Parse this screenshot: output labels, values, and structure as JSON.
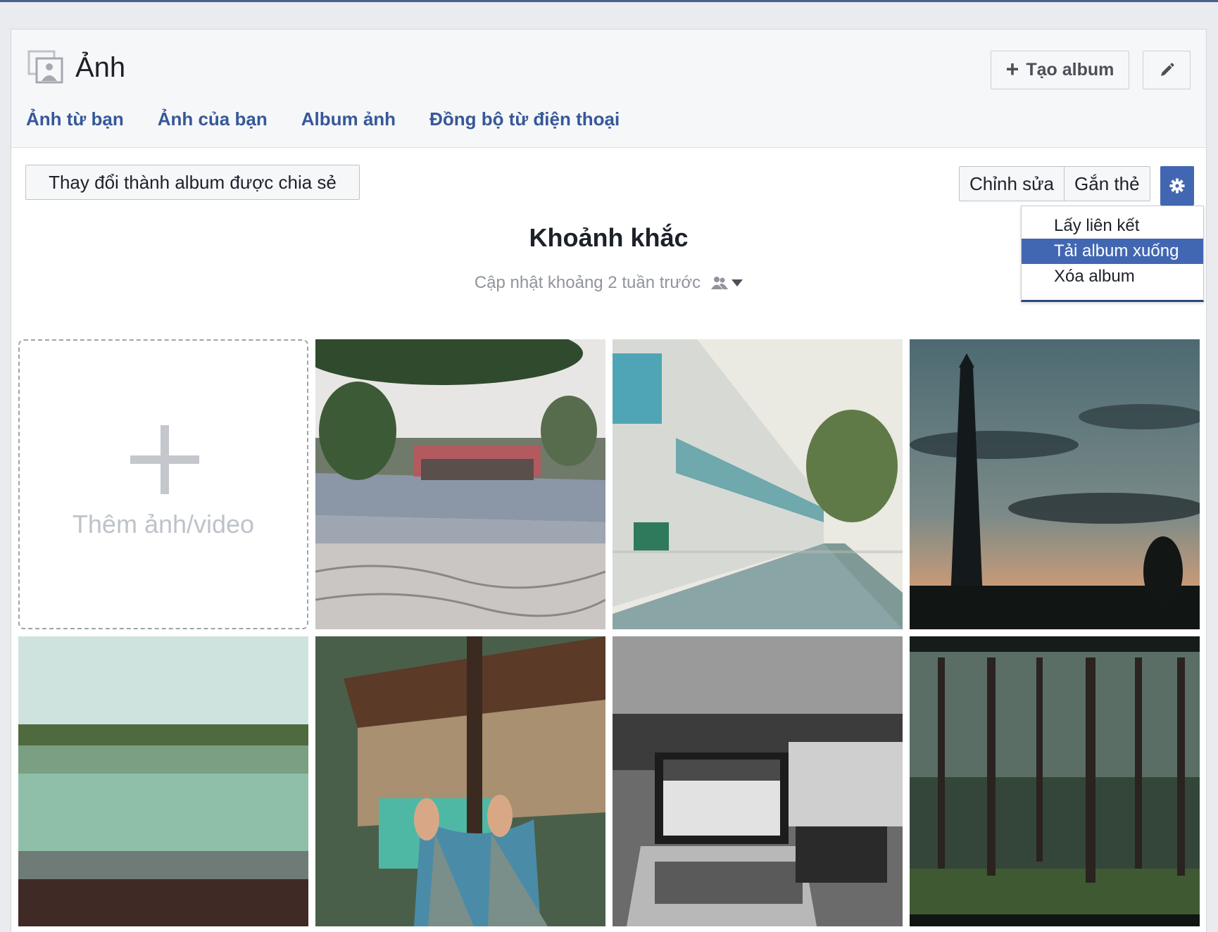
{
  "header": {
    "title": "Ảnh",
    "create_album_label": "Tạo album"
  },
  "tabs": [
    {
      "label": "Ảnh từ bạn"
    },
    {
      "label": "Ảnh của bạn"
    },
    {
      "label": "Album ảnh"
    },
    {
      "label": "Đồng bộ từ điện thoại"
    }
  ],
  "toolbar": {
    "shared_album_label": "Thay đổi thành album được chia sẻ",
    "edit_label": "Chỉnh sửa",
    "tag_label": "Gắn thẻ"
  },
  "album": {
    "title": "Khoảnh khắc",
    "updated": "Cập nhật khoảng 2 tuần trước"
  },
  "dropdown": {
    "items": [
      {
        "label": "Lấy liên kết",
        "active": false
      },
      {
        "label": "Tải album xuống",
        "active": true
      },
      {
        "label": "Xóa album",
        "active": false
      }
    ]
  },
  "grid": {
    "add_label": "Thêm ảnh/video"
  },
  "colors": {
    "link": "#365899",
    "accent": "#4267b2",
    "page_bg": "#e9ebee"
  }
}
